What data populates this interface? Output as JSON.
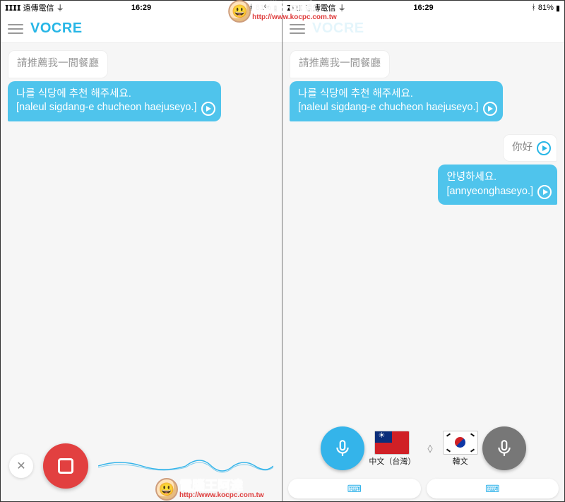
{
  "status": {
    "carrier": "遠傳電信",
    "wifi": "􀙇",
    "time": "16:29",
    "bt": "􀘾",
    "battery_pct": "81%"
  },
  "app": {
    "logo": "VOCRE"
  },
  "left": {
    "src": "請推薦我一間餐廳",
    "trg": "나를 식당에 추천 해주세요.\n[naleul sigdang-e chucheon haejuseyo.]"
  },
  "right": {
    "m1_src": "請推薦我一間餐廳",
    "m1_trg": "나를 식당에 추천 해주세요.\n[naleul sigdang-e chucheon haejuseyo.]",
    "m2_src": "你好",
    "m2_trg": "안녕하세요.\n[annyeonghaseyo.]"
  },
  "langs": {
    "a": "中文（台灣）",
    "b": "韓文"
  },
  "watermark": {
    "zh": "電腦王阿達",
    "url": "http://www.kocpc.com.tw"
  }
}
